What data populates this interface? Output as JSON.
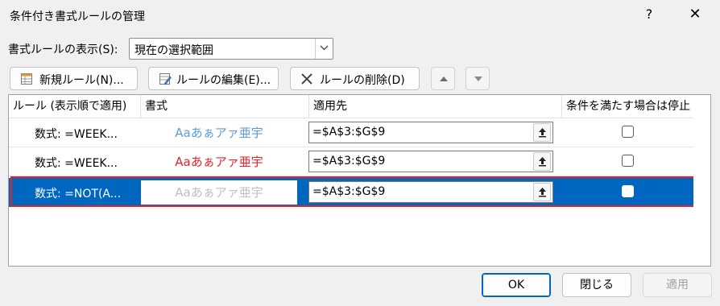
{
  "window": {
    "title": "条件付き書式ルールの管理",
    "help_label": "?",
    "close_label": "✕"
  },
  "show_rules": {
    "label": "書式ルールの表示(S):",
    "value": "現在の選択範囲"
  },
  "toolbar": {
    "new_rule": "新規ルール(N)...",
    "edit_rule": "ルールの編集(E)...",
    "delete_rule": "ルールの削除(D)"
  },
  "columns": {
    "rule": "ルール (表示順で適用)",
    "format": "書式",
    "applies_to": "適用先",
    "stop_if_true": "条件を満たす場合は停止"
  },
  "rules": [
    {
      "rule": "数式: =WEEK...",
      "sample": "Aaあぁアァ亜宇",
      "sample_color": "#5b9bd5",
      "applies_to": "=$A$3:$G$9",
      "stop_if_true": false,
      "selected": false
    },
    {
      "rule": "数式: =WEEK...",
      "sample": "Aaあぁアァ亜宇",
      "sample_color": "#e0242c",
      "applies_to": "=$A$3:$G$9",
      "stop_if_true": false,
      "selected": false
    },
    {
      "rule": "数式: =NOT(A...",
      "sample": "Aaあぁアァ亜宇",
      "sample_color": "#bfbfbf",
      "applies_to": "=$A$3:$G$9",
      "stop_if_true": false,
      "selected": true
    }
  ],
  "buttons": {
    "ok": "OK",
    "close": "閉じる",
    "apply": "適用"
  },
  "colors": {
    "selection": "#0067c0",
    "highlight_outline": "#e0242c"
  }
}
